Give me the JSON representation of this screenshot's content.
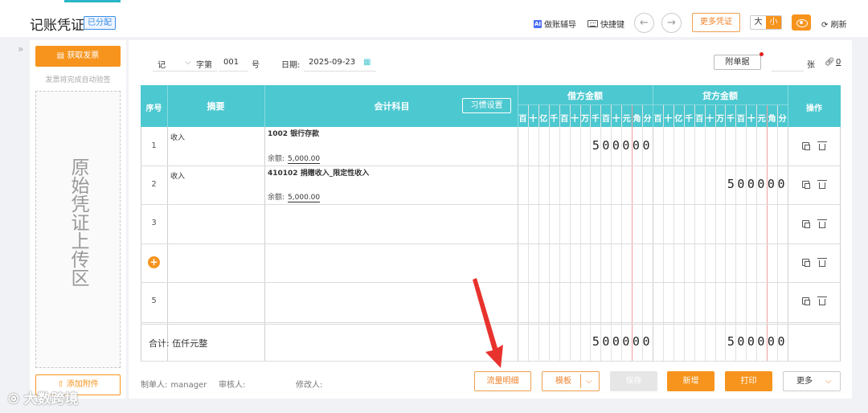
{
  "header": {
    "title": "记账凭证",
    "status_badge": "已分配",
    "assist_label": "做账辅导",
    "assist_icon": "ai-icon",
    "shortcut_label": "快捷键",
    "prev_icon": "←",
    "next_icon": "→",
    "more_voucher_label": "更多凭证",
    "size_large": "大",
    "size_small": "小",
    "refresh_label": "刷新"
  },
  "left_panel": {
    "get_invoice_label": "获取发票",
    "hint": "发票将完成自动验签",
    "upload_zone_text": "原始凭证上传区",
    "add_attachment_label": "添加附件"
  },
  "voucher_form": {
    "type_value": "记",
    "word_label": "字第",
    "number_value": "001",
    "number_suffix": "号",
    "date_label": "日期:",
    "date_value": "2025-09-23",
    "attachment_button_label": "附单据",
    "attachment_count": "",
    "attachment_unit": "张",
    "link_count": "0"
  },
  "table": {
    "headers": {
      "seq": "序号",
      "summary": "摘要",
      "account": "会计科目",
      "habit_button": "习惯设置",
      "debit": "借方金额",
      "credit": "贷方金额",
      "action": "操作"
    },
    "digit_units": [
      "百",
      "十",
      "亿",
      "千",
      "百",
      "十",
      "万",
      "千",
      "百",
      "十",
      "元",
      "角",
      "分"
    ],
    "rows": [
      {
        "seq": "1",
        "summary": "收入",
        "account": "1002 银行存款",
        "balance_label": "余额:",
        "balance": "5,000.00",
        "debit": "500000",
        "credit": ""
      },
      {
        "seq": "2",
        "summary": "收入",
        "account": "410102 捐赠收入_限定性收入",
        "balance_label": "余额:",
        "balance": "5,000.00",
        "debit": "",
        "credit": "500000"
      },
      {
        "seq": "3",
        "summary": "",
        "account": "",
        "balance_label": "",
        "balance": "",
        "debit": "",
        "credit": ""
      },
      {
        "seq": "+",
        "summary": "",
        "account": "",
        "balance_label": "",
        "balance": "",
        "debit": "",
        "credit": ""
      },
      {
        "seq": "5",
        "summary": "",
        "account": "",
        "balance_label": "",
        "balance": "",
        "debit": "",
        "credit": ""
      }
    ],
    "total_label": "合计: 伍仟元整",
    "total_debit": "500000",
    "total_credit": "500000"
  },
  "footer": {
    "maker_label": "制单人:",
    "maker_value": "manager",
    "reviewer_label": "审核人:",
    "modifier_label": "修改人:",
    "flow_detail_label": "流量明细",
    "template_label": "模板",
    "save_label": "保存",
    "new_label": "新增",
    "print_label": "打印",
    "more_label": "更多"
  },
  "watermark": "大数跨境",
  "colors": {
    "accent_orange": "#f7941d",
    "table_header": "#4cc8d0",
    "badge_blue": "#3a8ee6",
    "arrow_red": "#e8322d"
  }
}
